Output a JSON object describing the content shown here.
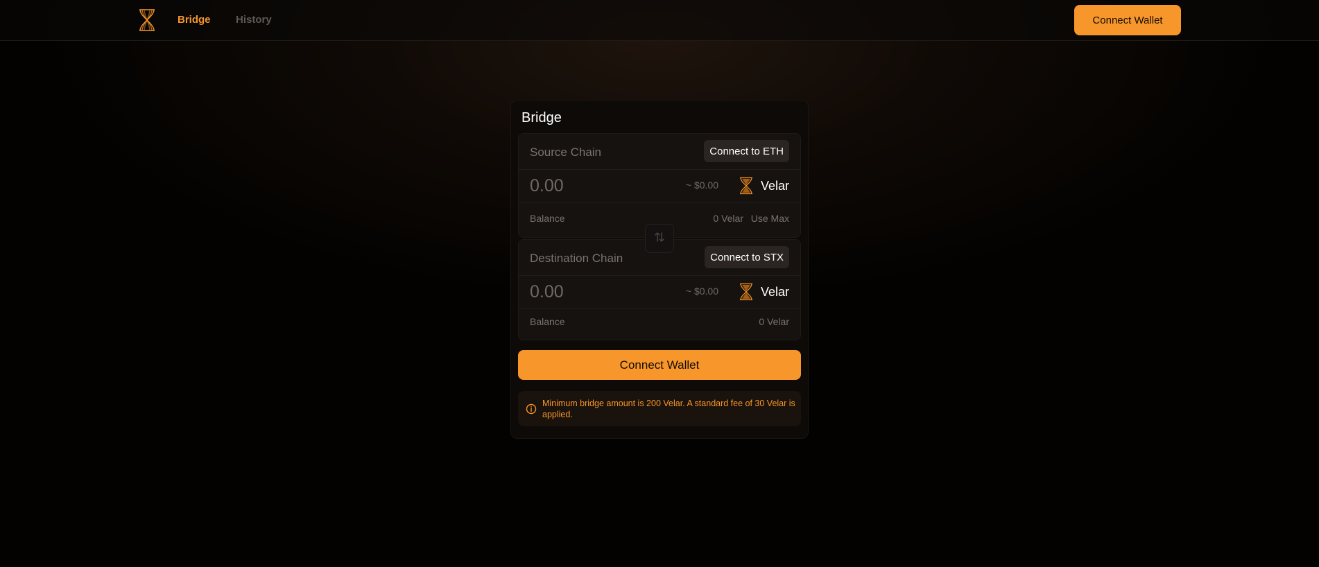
{
  "nav": {
    "items": [
      {
        "label": "Bridge",
        "active": true
      },
      {
        "label": "History",
        "active": false
      }
    ],
    "connect_wallet": "Connect Wallet"
  },
  "colors": {
    "accent": "#f7962a",
    "background": "#030201",
    "panel": "#161210"
  },
  "bridge": {
    "title": "Bridge",
    "source": {
      "label": "Source Chain",
      "connect": "Connect to ETH",
      "amount_placeholder": "0.00",
      "usd": "~ $0.00",
      "token": "Velar",
      "token_icon": "velar-hourglass-icon",
      "balance_label": "Balance",
      "balance_value": "0 Velar",
      "use_max": "Use Max"
    },
    "swap_icon": "swap-arrows-icon",
    "destination": {
      "label": "Destination Chain",
      "connect": "Connect to STX",
      "amount_placeholder": "0.00",
      "usd": "~ $0.00",
      "token": "Velar",
      "token_icon": "velar-hourglass-icon",
      "balance_label": "Balance",
      "balance_value": "0 Velar"
    },
    "connect_wallet": "Connect Wallet",
    "notice": "Minimum bridge amount is 200 Velar. A standard fee of 30 Velar is applied.",
    "notice_icon": "info-icon"
  }
}
